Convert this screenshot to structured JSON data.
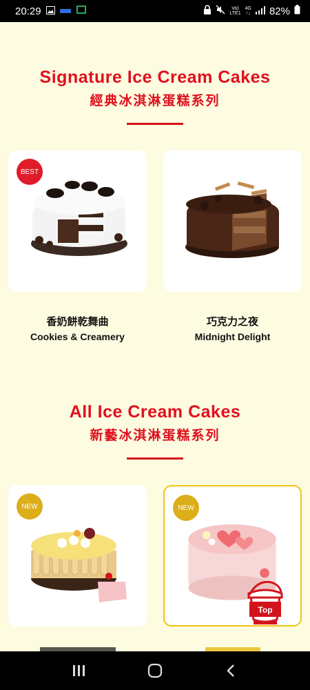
{
  "status_bar": {
    "time": "20:29",
    "battery": "82%",
    "network": "4G",
    "volte": "LTE1"
  },
  "sections": [
    {
      "title_en": "Signature Ice Cream Cakes",
      "title_zh": "經典冰淇淋蛋糕系列",
      "products": [
        {
          "name_zh": "香奶餅乾舞曲",
          "name_en": "Cookies & Creamery",
          "badge": "BEST"
        },
        {
          "name_zh": "巧克力之夜",
          "name_en": "Midnight Delight",
          "badge": ""
        }
      ]
    },
    {
      "title_en": "All Ice Cream Cakes",
      "title_zh": "新藝冰淇淋蛋糕系列",
      "products": [
        {
          "badge": "NEW"
        },
        {
          "badge": "NEW"
        }
      ]
    }
  ],
  "top_button": {
    "label": "Top"
  },
  "colors": {
    "accent_red": "#e0101e",
    "new_badge": "#dcae1a",
    "background": "#fdfbe0"
  },
  "icons": [
    "gallery-icon",
    "mute-icon",
    "signal-icon",
    "battery-icon",
    "recent-apps-icon",
    "home-icon",
    "back-icon"
  ]
}
